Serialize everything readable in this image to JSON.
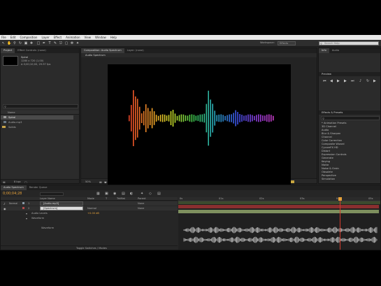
{
  "menu": [
    "File",
    "Edit",
    "Composition",
    "Layer",
    "Effect",
    "Animation",
    "View",
    "Window",
    "Help"
  ],
  "toolbar": {
    "workspace_label": "Workspace:",
    "workspace_value": "Effects",
    "search_placeholder": "Search Help"
  },
  "project": {
    "tabs": [
      "Project",
      "Effect Controls: (none)"
    ],
    "item_name": "Spiral",
    "item_lines": [
      "1280 x 720 (1.00)",
      "Δ 0;00;10;00, 29.97 fps"
    ],
    "list_header": "Name",
    "items": [
      "Spiral",
      "Audio.mp3",
      "Solids"
    ],
    "footer_label": "8 bpc"
  },
  "composition": {
    "tabs": [
      "Composition: Audio Spectrum",
      "Layer: (none)"
    ],
    "subtab": "Audio Spectrum",
    "zoom": "50%",
    "timecode": "0;00;04;28",
    "resolution": "Full",
    "view": "Active Camera",
    "views_count": "1 View"
  },
  "effects_panel": {
    "top_tabs": [
      "Info",
      "Audio"
    ],
    "preview_tab": "Preview",
    "effects_tab": "Effects & Presets",
    "search_placeholder": "",
    "categories": [
      "* Animation Presets",
      "3D Channel",
      "Audio",
      "Blur & Sharpen",
      "Channel",
      "Color Correction",
      "Composite Wizard",
      "CycoreFX HD",
      "Distort",
      "Expression Controls",
      "Generate",
      "Keying",
      "Matte",
      "Noise & Grain",
      "Obsolete",
      "Perspective",
      "Simulation"
    ]
  },
  "timeline": {
    "tabs": [
      "Audio Spectrum",
      "Render Queue"
    ],
    "timecode": "0;00;04;28",
    "col_headers": [
      "Layer Name",
      "Mode",
      "T",
      "TrkMat",
      "Parent"
    ],
    "layers": [
      {
        "num": "1",
        "name": "[Audio.mp3]",
        "mode": "Normal",
        "parent": "None"
      },
      {
        "num": "2",
        "name": "[Spectrum]",
        "mode": "Normal",
        "parent": "None"
      }
    ],
    "sub_rows": [
      "Audio Levels",
      "Waveform",
      "Waveform"
    ],
    "audio_levels_value": "+0.00 dB",
    "ruler": [
      "0s",
      "01s",
      "02s",
      "03s",
      "04s",
      "05s"
    ],
    "footer": "Toggle Switches / Modes"
  },
  "colors": {
    "accent_orange": "#e7a23a",
    "layer_red": "#8a2f2f",
    "layer_green": "#7e8f5e",
    "playhead": "#d33a2c"
  }
}
